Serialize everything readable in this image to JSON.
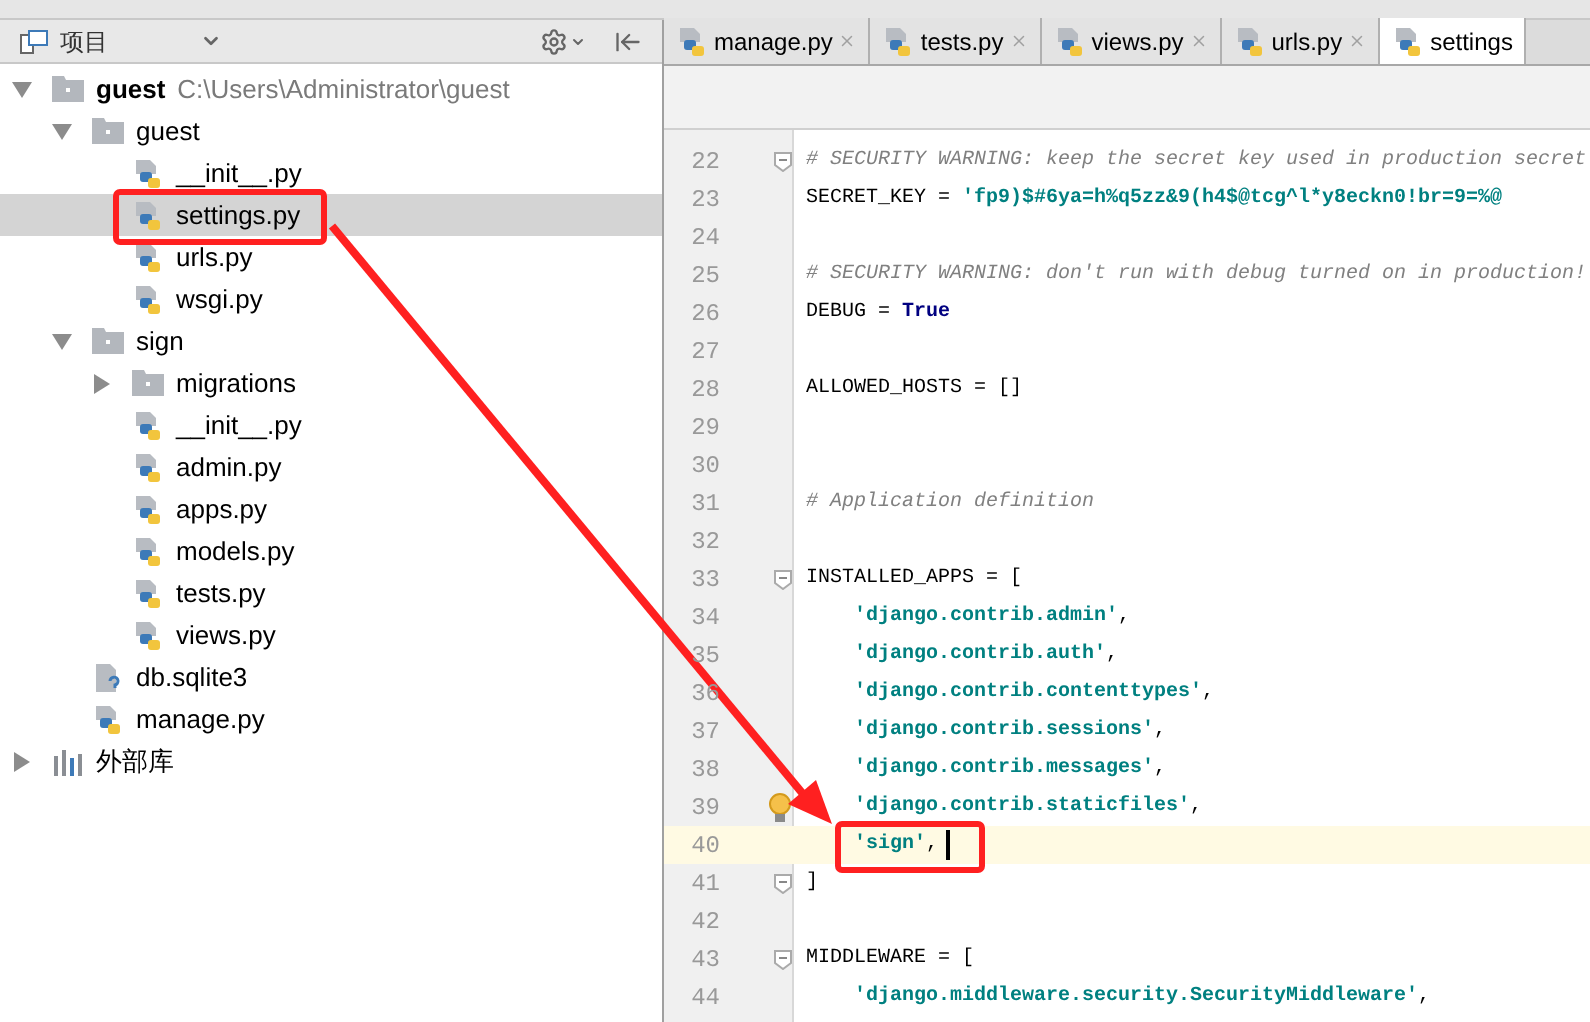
{
  "project_panel": {
    "title": "项目",
    "tree": [
      {
        "kind": "folder",
        "name": "guest",
        "path": "C:\\Users\\Administrator\\guest",
        "root": true,
        "expanded": true,
        "selected": false,
        "children": [
          {
            "kind": "folder",
            "name": "guest",
            "root": false,
            "expanded": true,
            "selected": false,
            "children": [
              {
                "kind": "python",
                "name": "__init__.py",
                "selected": false
              },
              {
                "kind": "python",
                "name": "settings.py",
                "selected": true
              },
              {
                "kind": "python",
                "name": "urls.py",
                "selected": false
              },
              {
                "kind": "python",
                "name": "wsgi.py",
                "selected": false
              }
            ]
          },
          {
            "kind": "folder",
            "name": "sign",
            "root": false,
            "expanded": true,
            "selected": false,
            "children": [
              {
                "kind": "folder",
                "name": "migrations",
                "root": false,
                "expanded": false,
                "selected": false
              },
              {
                "kind": "python",
                "name": "__init__.py",
                "selected": false
              },
              {
                "kind": "python",
                "name": "admin.py",
                "selected": false
              },
              {
                "kind": "python",
                "name": "apps.py",
                "selected": false
              },
              {
                "kind": "python",
                "name": "models.py",
                "selected": false
              },
              {
                "kind": "python",
                "name": "tests.py",
                "selected": false
              },
              {
                "kind": "python",
                "name": "views.py",
                "selected": false
              }
            ]
          },
          {
            "kind": "unknown",
            "name": "db.sqlite3",
            "selected": false
          },
          {
            "kind": "python",
            "name": "manage.py",
            "selected": false
          }
        ]
      },
      {
        "kind": "library",
        "name": "外部库",
        "root": false,
        "expanded": false,
        "selected": false
      }
    ]
  },
  "editor": {
    "tabs": [
      {
        "label": "manage.py",
        "selected": false
      },
      {
        "label": "tests.py",
        "selected": false
      },
      {
        "label": "views.py",
        "selected": false
      },
      {
        "label": "urls.py",
        "selected": false
      },
      {
        "label": "settings",
        "selected": true
      }
    ],
    "lines": [
      {
        "number": "22",
        "gutter": {
          "kind": "fold"
        },
        "current": false,
        "indented": false,
        "segments": [
          {
            "kind": "comment",
            "text": "# SECURITY WARNING: keep the secret key used in production secret"
          }
        ]
      },
      {
        "number": "23",
        "current": false,
        "indented": false,
        "segments": [
          {
            "kind": "plain",
            "text": "SECRET_KEY = "
          },
          {
            "kind": "string",
            "text": "'fp9)$#6ya=h%q5zz&9(h4$@tcg^l*y8eckn0!br=9=%@"
          }
        ]
      },
      {
        "number": "24",
        "current": false
      },
      {
        "number": "25",
        "current": false,
        "indented": false,
        "segments": [
          {
            "kind": "comment",
            "text": "# SECURITY WARNING: don't run with debug turned on in production!"
          }
        ]
      },
      {
        "number": "26",
        "current": false,
        "indented": false,
        "segments": [
          {
            "kind": "plain",
            "text": "DEBUG = "
          },
          {
            "kind": "keyword",
            "text": "True"
          }
        ]
      },
      {
        "number": "27",
        "current": false
      },
      {
        "number": "28",
        "current": false,
        "indented": false,
        "segments": [
          {
            "kind": "plain",
            "text": "ALLOWED_HOSTS = []"
          }
        ]
      },
      {
        "number": "29",
        "current": false
      },
      {
        "number": "30",
        "current": false
      },
      {
        "number": "31",
        "current": false,
        "indented": false,
        "segments": [
          {
            "kind": "comment",
            "text": "# Application definition"
          }
        ]
      },
      {
        "number": "32",
        "current": false
      },
      {
        "number": "33",
        "gutter": {
          "kind": "fold"
        },
        "current": false,
        "indented": false,
        "segments": [
          {
            "kind": "plain",
            "text": "INSTALLED_APPS = ["
          }
        ]
      },
      {
        "number": "34",
        "current": false,
        "indented": true,
        "segments": [
          {
            "kind": "string",
            "text": "'django.contrib.admin'"
          },
          {
            "kind": "plain",
            "text": ","
          }
        ]
      },
      {
        "number": "35",
        "current": false,
        "indented": true,
        "segments": [
          {
            "kind": "string",
            "text": "'django.contrib.auth'"
          },
          {
            "kind": "plain",
            "text": ","
          }
        ]
      },
      {
        "number": "36",
        "current": false,
        "indented": true,
        "segments": [
          {
            "kind": "string",
            "text": "'django.contrib.contenttypes'"
          },
          {
            "kind": "plain",
            "text": ","
          }
        ]
      },
      {
        "number": "37",
        "current": false,
        "indented": true,
        "segments": [
          {
            "kind": "string",
            "text": "'django.contrib.sessions'"
          },
          {
            "kind": "plain",
            "text": ","
          }
        ]
      },
      {
        "number": "38",
        "current": false,
        "indented": true,
        "segments": [
          {
            "kind": "string",
            "text": "'django.contrib.messages'"
          },
          {
            "kind": "plain",
            "text": ","
          }
        ]
      },
      {
        "number": "39",
        "gutter": {
          "kind": "bulb"
        },
        "current": false,
        "indented": true,
        "segments": [
          {
            "kind": "string",
            "text": "'django.contrib.staticfiles'"
          },
          {
            "kind": "plain",
            "text": ","
          }
        ]
      },
      {
        "number": "40",
        "current": true,
        "indented": true,
        "segments": [
          {
            "kind": "string",
            "text": "'sign'"
          },
          {
            "kind": "plain",
            "text": ","
          }
        ]
      },
      {
        "number": "41",
        "gutter": {
          "kind": "fold"
        },
        "current": false,
        "indented": false,
        "segments": [
          {
            "kind": "plain",
            "text": "]"
          }
        ]
      },
      {
        "number": "42",
        "current": false
      },
      {
        "number": "43",
        "gutter": {
          "kind": "fold"
        },
        "current": false,
        "indented": false,
        "segments": [
          {
            "kind": "plain",
            "text": "MIDDLEWARE = ["
          }
        ]
      },
      {
        "number": "44",
        "current": false,
        "indented": true,
        "segments": [
          {
            "kind": "string",
            "text": "'django.middleware.security.SecurityMiddleware'"
          },
          {
            "kind": "plain",
            "text": ","
          }
        ]
      }
    ]
  }
}
